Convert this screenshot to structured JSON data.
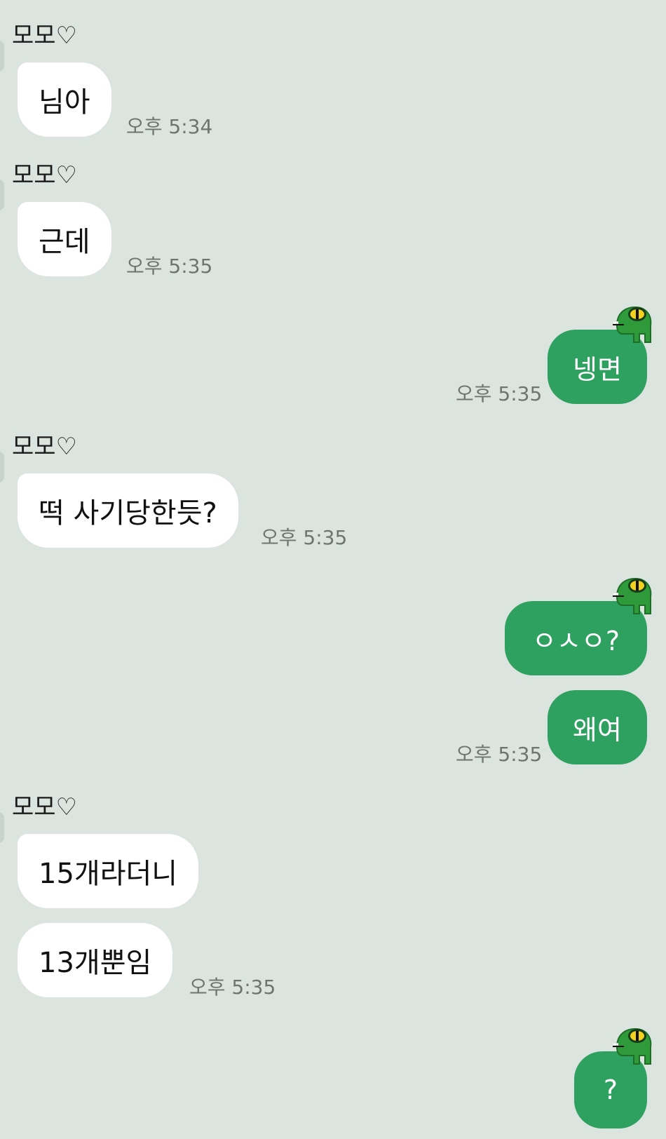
{
  "conversation": {
    "sender_name": "모모♡",
    "msg1": {
      "text": "님아",
      "time": "오후 5:34"
    },
    "msg2": {
      "text": "근데",
      "time": "오후 5:35"
    },
    "msg3": {
      "text": "넹면",
      "time": "오후 5:35"
    },
    "msg4": {
      "text": "떡 사기당한듯?",
      "time": "오후 5:35"
    },
    "msg5": {
      "text": "ㅇㅅㅇ?"
    },
    "msg6": {
      "text": "왜여",
      "time": "오후 5:35"
    },
    "msg7": {
      "text": "15개라더니"
    },
    "msg8": {
      "text": "13개뿐임",
      "time": "오후 5:35"
    },
    "msg9": {
      "text": "?"
    }
  },
  "colors": {
    "background": "#dce4df",
    "incoming_bubble": "#ffffff",
    "outgoing_bubble": "#2ea160",
    "timestamp": "#6e7571"
  },
  "icons": {
    "sticker": "frog-sticker-icon"
  }
}
